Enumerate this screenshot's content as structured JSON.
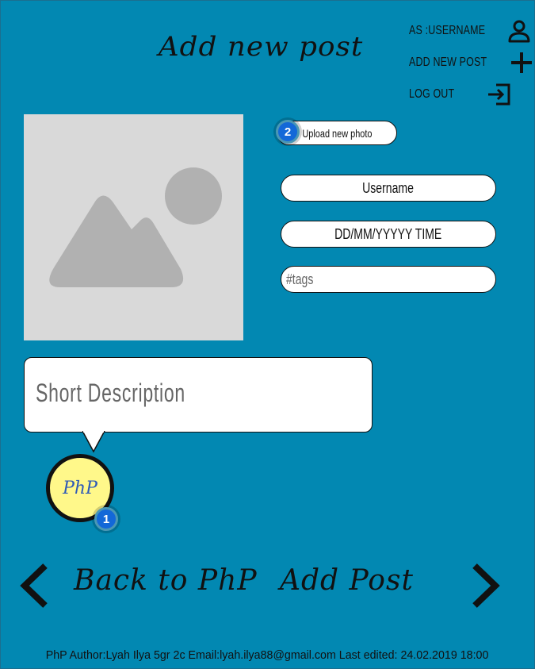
{
  "header": {
    "title": "Add new post"
  },
  "topnav": {
    "items": [
      {
        "label": "AS :USERNAME",
        "icon": "user-icon"
      },
      {
        "label": "ADD NEW POST",
        "icon": "plus-icon"
      },
      {
        "label": "LOG OUT",
        "icon": "logout-icon"
      }
    ]
  },
  "photo": {
    "icon": "image-placeholder-icon",
    "upload_label": "Upload new photo"
  },
  "form": {
    "username_value": "Username",
    "datetime_value": "DD/MM/YYYYY   TIME",
    "tags_placeholder": "#tags"
  },
  "description": {
    "placeholder": "Short Description"
  },
  "logo": {
    "text": "PhP"
  },
  "badges": [
    "1",
    "2"
  ],
  "bottomnav": {
    "back_label": "Back to PhP",
    "add_label": "Add Post",
    "prev_icon": "chevron-left-icon",
    "next_icon": "chevron-right-icon"
  },
  "footer": {
    "text": "PhP Author:Lyah Ilya 5gr 2c Email:lyah.ilya88@gmail.com Last edited: 24.02.2019 18:00"
  },
  "colors": {
    "background": "#0288b2",
    "logo_fill": "#fff88a",
    "badge": "#1368d8",
    "placeholder_bg": "#d9d9d9"
  }
}
